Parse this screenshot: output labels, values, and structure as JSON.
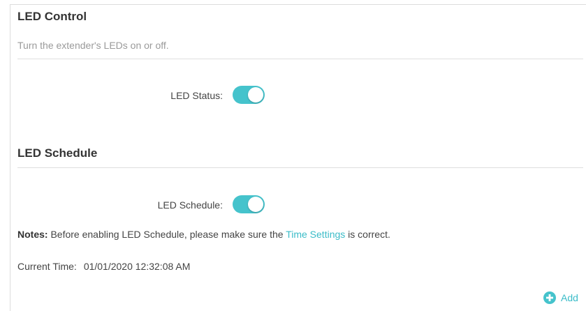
{
  "led_control": {
    "title": "LED Control",
    "description": "Turn the extender's LEDs on or off.",
    "status_label": "LED Status:",
    "status_on": true
  },
  "led_schedule": {
    "title": "LED Schedule",
    "schedule_label": "LED Schedule:",
    "schedule_on": true,
    "notes_label": "Notes:",
    "notes_text_before": "Before enabling LED Schedule, please make sure the",
    "notes_link": "Time Settings",
    "notes_text_after": "is correct.",
    "current_time_label": "Current Time:",
    "current_time_value": "01/01/2020 12:32:08 AM",
    "add_label": "Add",
    "add_icon": "plus-circle-icon"
  },
  "colors": {
    "accent": "#45c3cc",
    "link": "#3bbcc8"
  }
}
